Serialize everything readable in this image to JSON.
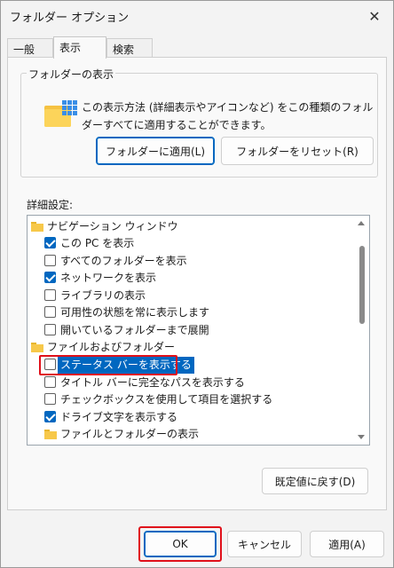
{
  "window": {
    "title": "フォルダー オプション"
  },
  "tabs": [
    {
      "label": "一般"
    },
    {
      "label": "表示"
    },
    {
      "label": "検索"
    }
  ],
  "folder_view": {
    "group_title": "フォルダーの表示",
    "description": "この表示方法 (詳細表示やアイコンなど) をこの種類のフォルダーすべてに適用することができます。",
    "apply_button": "フォルダーに適用(L)",
    "reset_button": "フォルダーをリセット(R)"
  },
  "advanced": {
    "label": "詳細設定:",
    "items": [
      {
        "type": "folder",
        "label": "ナビゲーション ウィンドウ"
      },
      {
        "type": "checkbox",
        "label": "この PC を表示",
        "checked": true
      },
      {
        "type": "checkbox",
        "label": "すべてのフォルダーを表示",
        "checked": false
      },
      {
        "type": "checkbox",
        "label": "ネットワークを表示",
        "checked": true
      },
      {
        "type": "checkbox",
        "label": "ライブラリの表示",
        "checked": false
      },
      {
        "type": "checkbox",
        "label": "可用性の状態を常に表示します",
        "checked": false
      },
      {
        "type": "checkbox",
        "label": "開いているフォルダーまで展開",
        "checked": false
      },
      {
        "type": "folder",
        "label": "ファイルおよびフォルダー"
      },
      {
        "type": "checkbox",
        "label": "ステータス バーを表示する",
        "checked": false,
        "selected": true
      },
      {
        "type": "checkbox",
        "label": "タイトル バーに完全なパスを表示する",
        "checked": false
      },
      {
        "type": "checkbox",
        "label": "チェックボックスを使用して項目を選択する",
        "checked": false
      },
      {
        "type": "checkbox",
        "label": "ドライブ文字を表示する",
        "checked": true
      },
      {
        "type": "folder",
        "label": "ファイルとフォルダーの表示"
      }
    ],
    "restore_button": "既定値に戻す(D)"
  },
  "footer": {
    "ok": "OK",
    "cancel": "キャンセル",
    "apply": "適用(A)"
  },
  "colors": {
    "accent": "#0067c0",
    "highlight": "#e0101a"
  }
}
